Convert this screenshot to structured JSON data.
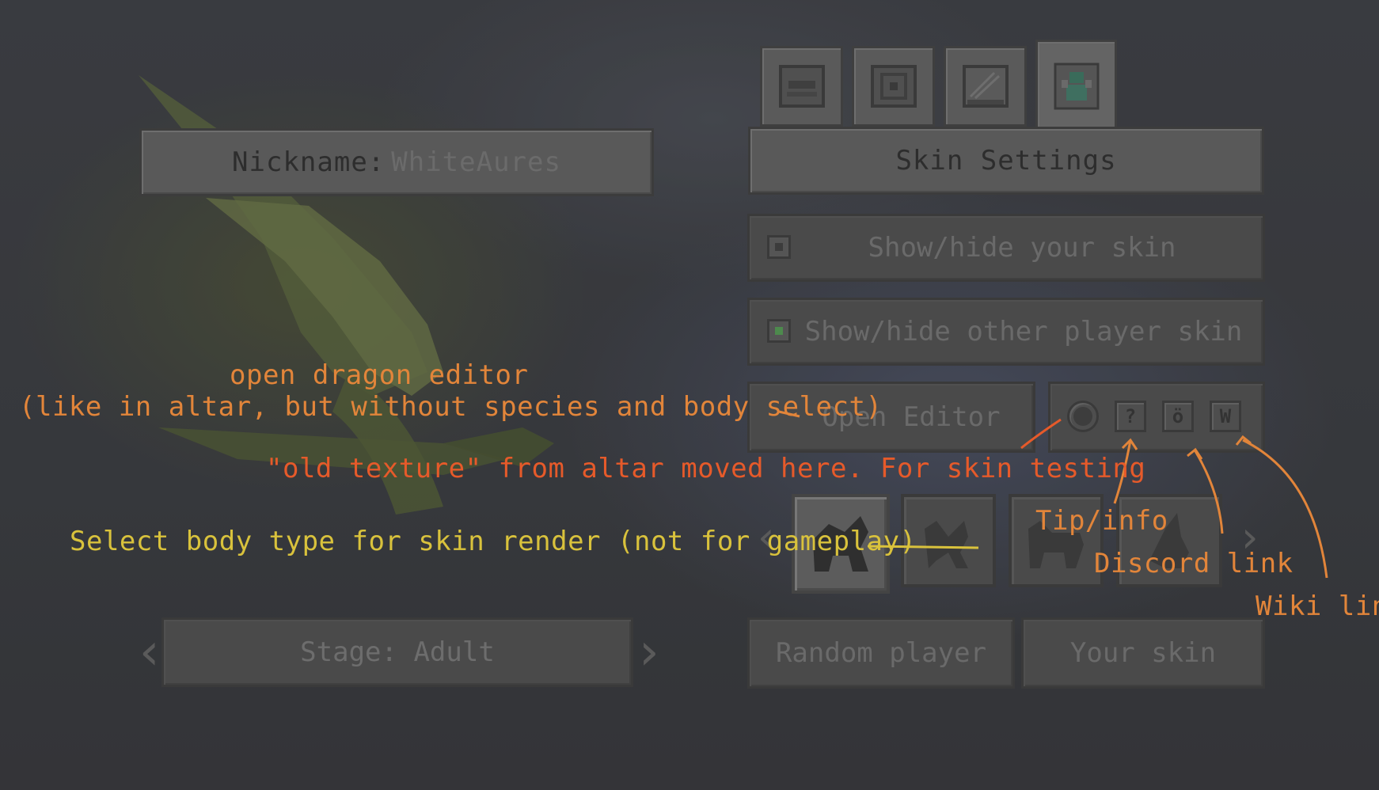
{
  "nickname": {
    "label": "Nickname:",
    "value": "WhiteAures"
  },
  "tabs": [
    {
      "name": "tab-altar",
      "icon": "altar-icon"
    },
    {
      "name": "tab-inventory",
      "icon": "inventory-icon"
    },
    {
      "name": "tab-book",
      "icon": "book-icon"
    },
    {
      "name": "tab-skin",
      "icon": "skin-icon",
      "active": true
    }
  ],
  "skin_settings": {
    "title": "Skin Settings",
    "show_hide_own": {
      "label": "Show/hide your skin",
      "checked": false
    },
    "show_hide_other": {
      "label": "Show/hide other player skin",
      "checked": true
    },
    "open_editor": "Open Editor",
    "icon_buttons": [
      {
        "name": "old-texture-button",
        "icon": "circle-icon",
        "glyph": ""
      },
      {
        "name": "tip-info-button",
        "icon": "question-icon",
        "glyph": "?"
      },
      {
        "name": "discord-link-button",
        "icon": "discord-icon",
        "glyph": "ö"
      },
      {
        "name": "wiki-link-button",
        "icon": "wiki-icon",
        "glyph": "W"
      }
    ],
    "random_player": "Random player",
    "your_skin": "Your skin"
  },
  "stage": {
    "label": "Stage: Adult"
  },
  "annotations": {
    "open_editor_line1": "open dragon editor",
    "open_editor_line2": "(like in altar, but without species and body select)",
    "old_texture": "\"old texture\" from altar moved here. For skin testing",
    "body_type": "Select body type for skin render (not for gameplay)",
    "tip_info": "Tip/info",
    "discord": "Discord link",
    "wiki": "Wiki link"
  },
  "colors": {
    "orange": "#e2853a",
    "red": "#e65a2a",
    "yellow": "#d9c23c"
  }
}
